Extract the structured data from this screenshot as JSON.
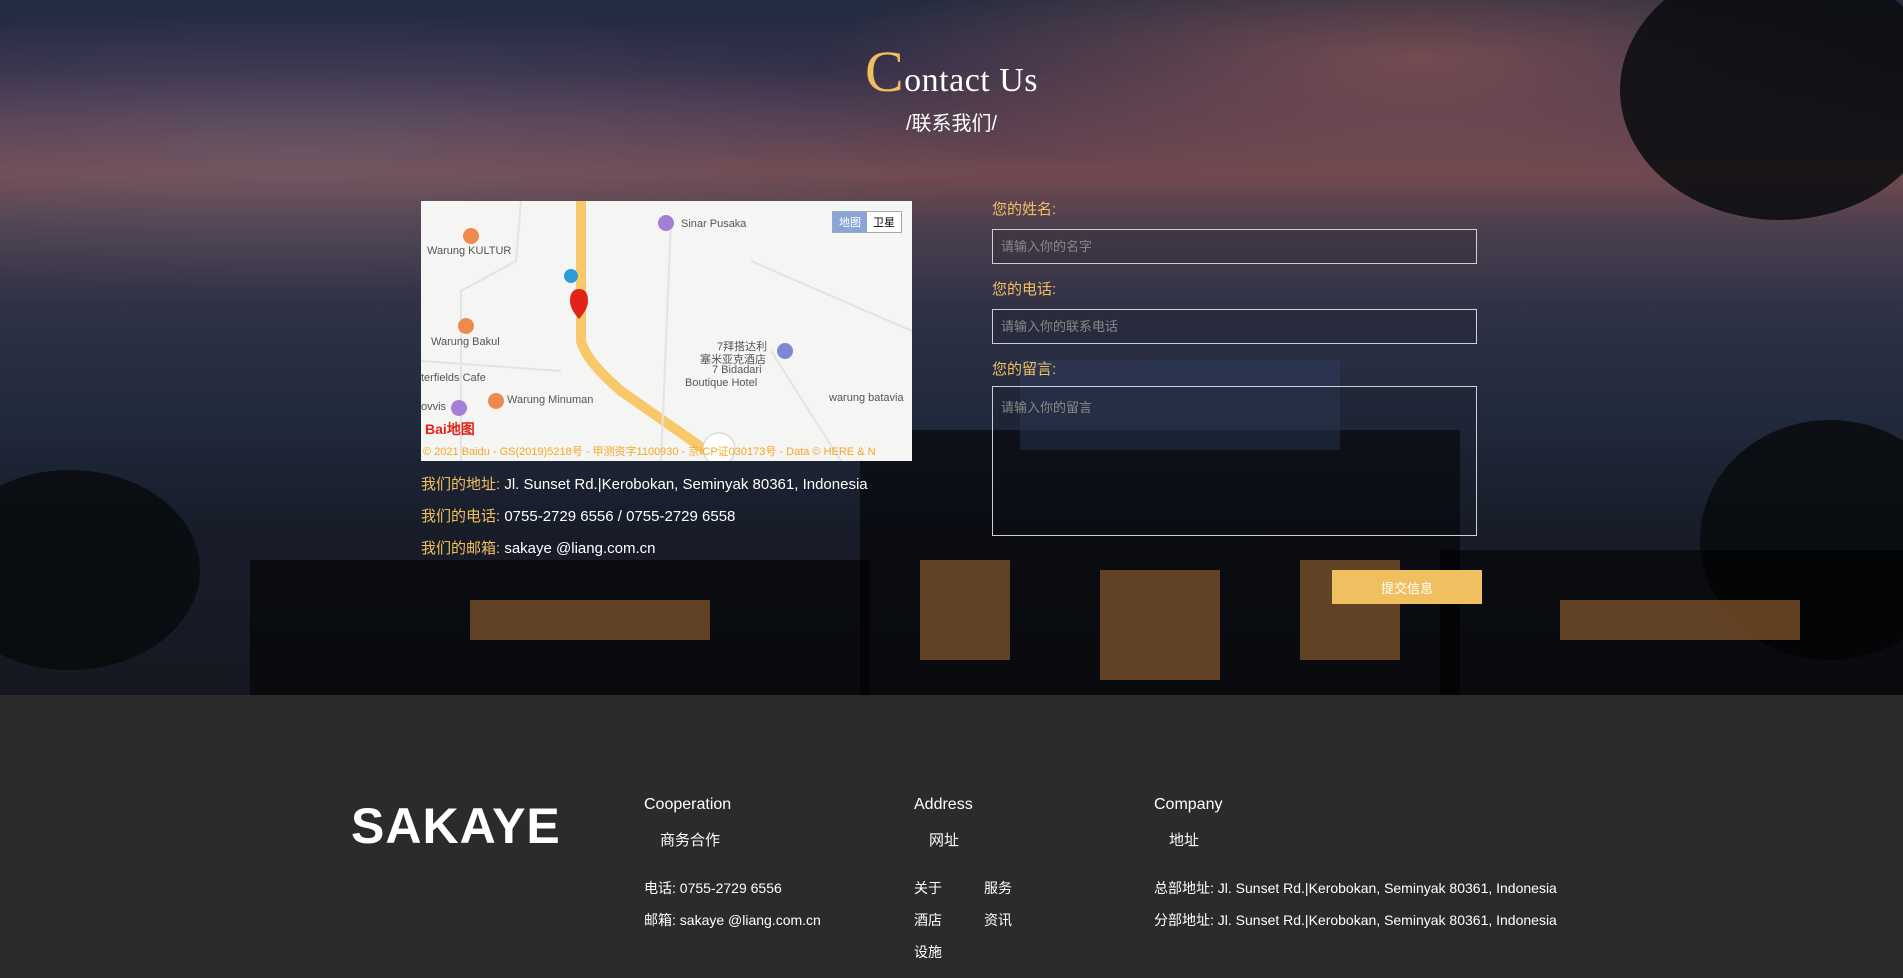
{
  "header": {
    "title_initial": "C",
    "title_rest": "ontact Us",
    "subtitle": "/联系我们/"
  },
  "map": {
    "switch": [
      "地图",
      "卫星"
    ],
    "labels": [
      "Warung KULTUR",
      "Sinar Pusaka",
      "Warung Bakul",
      "7拜搭达利",
      "塞米亚克酒店",
      "7 Bidadari",
      "Boutique Hotel",
      "terfields Cafe",
      "Warung Minuman",
      "warung batavia",
      "ovvis"
    ],
    "logo": "Bai地图",
    "copyright": "© 2021 Baidu - GS(2019)5218号 - 甲测资字1100930 - 京ICP证030173号 - Data © HERE & N"
  },
  "contact": {
    "address_label": "我们的地址:",
    "address": " Jl. Sunset Rd.|Kerobokan, Seminyak 80361, Indonesia",
    "phone_label": "我们的电话:",
    "phone": " 0755-2729 6556 / 0755-2729 6558",
    "email_label": "我们的邮箱:",
    "email": " sakaye @liang.com.cn"
  },
  "form": {
    "name_label": "您的姓名:",
    "name_placeholder": "请输入你的名字",
    "phone_label": "您的电话:",
    "phone_placeholder": "请输入你的联系电话",
    "message_label": "您的留言:",
    "message_placeholder": "请输入你的留言",
    "submit": "提交信息"
  },
  "footer": {
    "brand": "SAKAYE",
    "cooperation": {
      "heading": "Cooperation",
      "sub": "商务合作",
      "phone": "电话: 0755-2729 6556",
      "email": "邮箱: sakaye @liang.com.cn"
    },
    "address": {
      "heading": "Address",
      "sub": "网址",
      "links": [
        "关于",
        "服务",
        "酒店",
        "资讯",
        "设施"
      ]
    },
    "company": {
      "heading": "Company",
      "sub": "地址",
      "hq": "总部地址: Jl. Sunset Rd.|Kerobokan, Seminyak 80361, Indonesia",
      "branch": "分部地址: Jl. Sunset Rd.|Kerobokan, Seminyak 80361, Indonesia"
    }
  }
}
